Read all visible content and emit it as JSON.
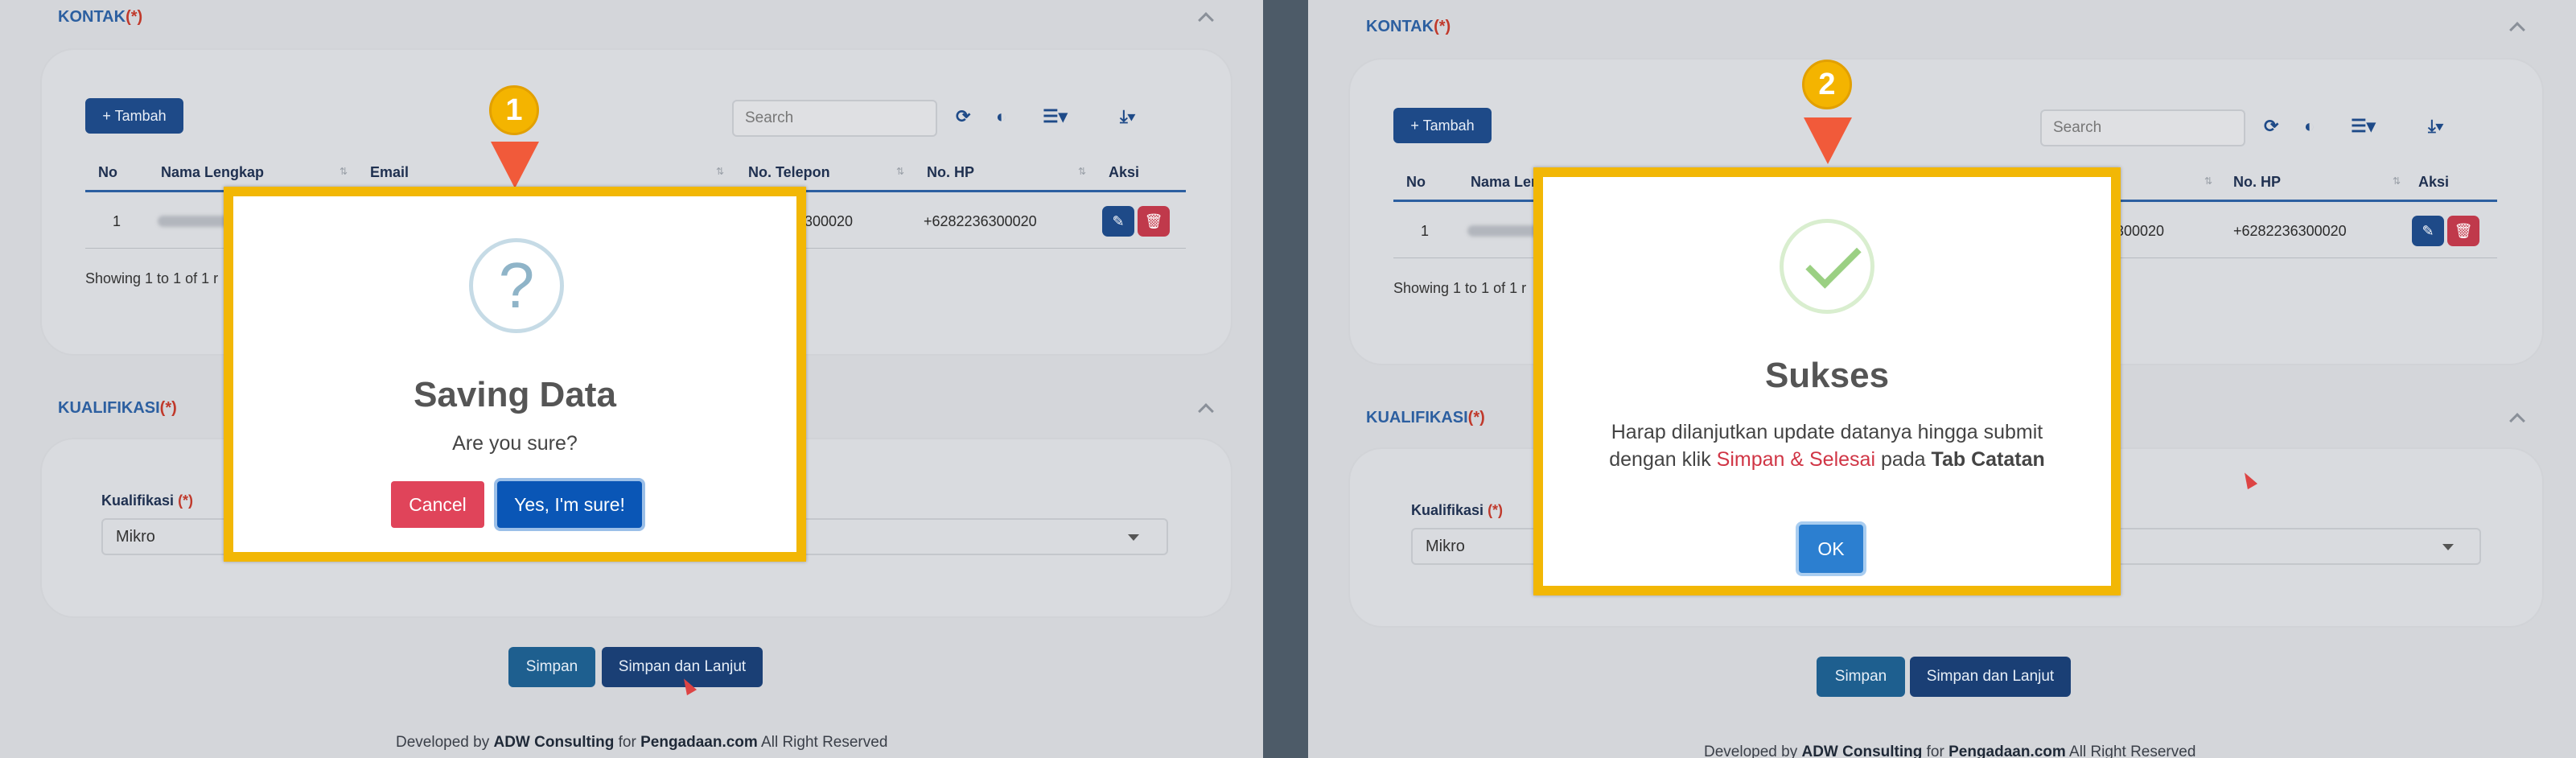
{
  "sections": {
    "kontak_title": "KONTAK",
    "kualifikasi_title": "KUALIFIKASI",
    "required_mark": "(*)"
  },
  "toolbar": {
    "add_label": "+ Tambah",
    "search_placeholder": "Search",
    "refresh_icon": "refresh-icon",
    "toggle_icon": "toggle-icon",
    "columns_icon": "columns-icon",
    "export_icon": "download-icon"
  },
  "table": {
    "headers": [
      "No",
      "Nama Lengkap",
      "Email",
      "No. Telepon",
      "No. HP",
      "Aksi"
    ],
    "rows": [
      {
        "no": "1",
        "telepon_left": "300020",
        "telepon_right": "300020",
        "hp": "+6282236300020"
      }
    ],
    "showing_left": "Showing 1 to 1 of 1 r",
    "showing_right": "Showing 1 to 1 of 1 r"
  },
  "kualifikasi": {
    "label": "Kualifikasi",
    "value": "Mikro"
  },
  "buttons": {
    "simpan": "Simpan",
    "simpan_lanjut": "Simpan dan Lanjut"
  },
  "footer": {
    "prefix": "Developed by",
    "company": "ADW Consulting",
    "mid": "for",
    "site": "Pengadaan.com",
    "suffix": "All Right Reserved"
  },
  "modal_left": {
    "badge": "1",
    "icon": "question-icon",
    "title": "Saving Data",
    "text": "Are you sure?",
    "cancel": "Cancel",
    "confirm": "Yes, I'm sure!"
  },
  "modal_right": {
    "badge": "2",
    "icon": "check-icon",
    "title": "Sukses",
    "line1": "Harap dilanjutkan update datanya hingga submit",
    "line2_a": "dengan klik",
    "line2_link": "Simpan & Selesai",
    "line2_b": "pada",
    "line2_bold": "Tab Catatan",
    "ok": "OK"
  },
  "colors": {
    "callout": "#f2b705",
    "pointer": "#f15a3a",
    "primary": "#1e4a88",
    "danger": "#c0394b"
  }
}
